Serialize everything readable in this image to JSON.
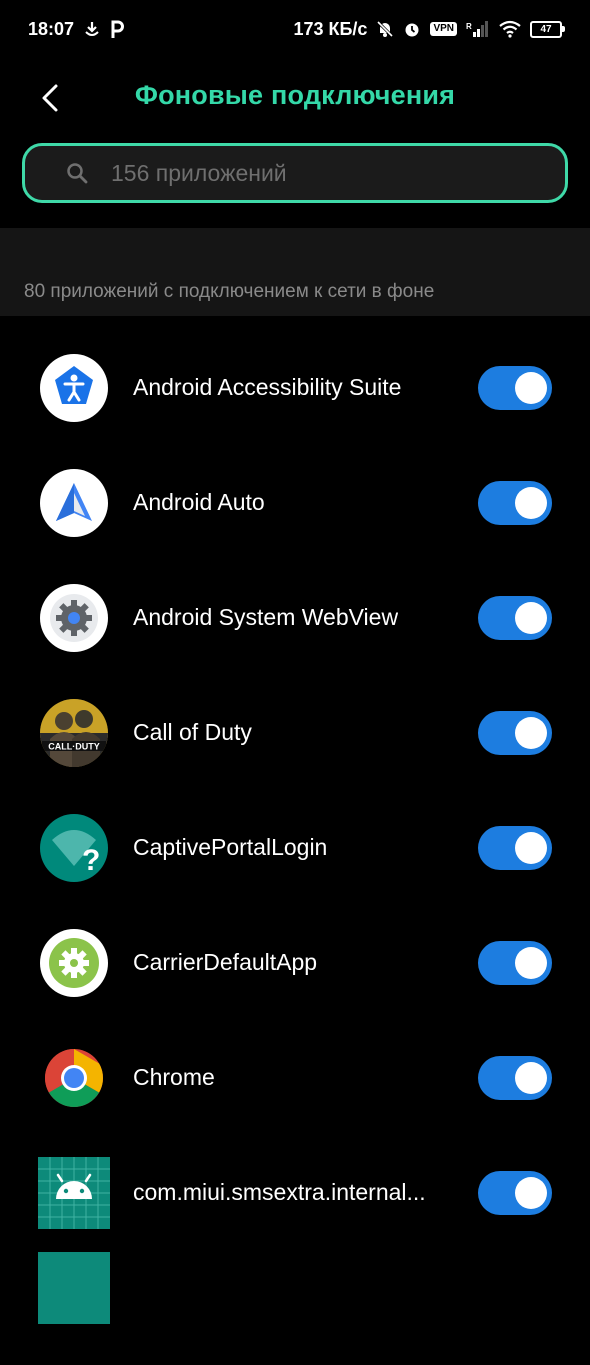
{
  "status_bar": {
    "time": "18:07",
    "left_icons": [
      "download-icon",
      "p-icon"
    ],
    "speed": "173 КБ/с",
    "vpn": "VPN",
    "signal_label": "R",
    "battery": "47"
  },
  "header": {
    "back_icon": "chevron-left-icon",
    "title": "Фоновые подключения"
  },
  "search": {
    "placeholder": "156 приложений",
    "value": ""
  },
  "section": {
    "label": "80 приложений с подключением к сети в фоне"
  },
  "colors": {
    "accent": "#34d8a8",
    "toggle_on": "#1d7de0",
    "background": "#000000"
  },
  "apps": [
    {
      "name": "Android Accessibility Suite",
      "icon": "accessibility-icon",
      "enabled": true
    },
    {
      "name": "Android Auto",
      "icon": "android-auto-icon",
      "enabled": true
    },
    {
      "name": "Android System WebView",
      "icon": "webview-gear-icon",
      "enabled": true
    },
    {
      "name": "Call of Duty",
      "icon": "call-of-duty-icon",
      "enabled": true
    },
    {
      "name": "CaptivePortalLogin",
      "icon": "captive-portal-icon",
      "enabled": true
    },
    {
      "name": "CarrierDefaultApp",
      "icon": "carrier-gear-icon",
      "enabled": true
    },
    {
      "name": "Chrome",
      "icon": "chrome-icon",
      "enabled": true
    },
    {
      "name": "com.miui.smsextra.internal...",
      "icon": "android-robot-icon",
      "enabled": true
    }
  ]
}
